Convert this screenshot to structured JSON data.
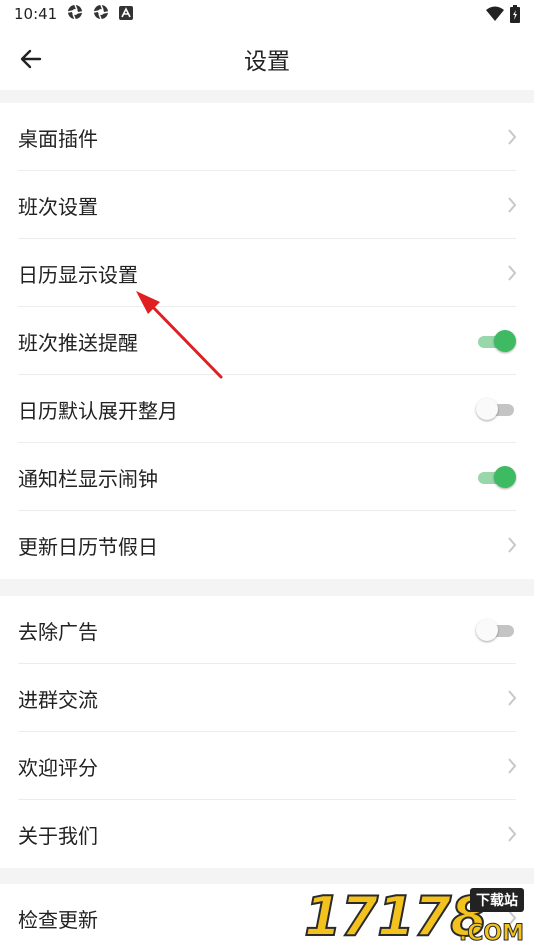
{
  "status_bar": {
    "time": "10:41",
    "left_icons": [
      "aperture-icon",
      "aperture-icon",
      "a-box-icon"
    ],
    "right_icons": [
      "wifi-icon",
      "battery-charging-icon"
    ]
  },
  "header": {
    "title": "设置",
    "back_icon": "arrow-left-icon"
  },
  "groups": [
    {
      "rows": [
        {
          "label": "桌面插件",
          "control": "chevron"
        },
        {
          "label": "班次设置",
          "control": "chevron"
        },
        {
          "label": "日历显示设置",
          "control": "chevron"
        },
        {
          "label": "班次推送提醒",
          "control": "toggle",
          "on": true
        },
        {
          "label": "日历默认展开整月",
          "control": "toggle",
          "on": false
        },
        {
          "label": "通知栏显示闹钟",
          "control": "toggle",
          "on": true
        },
        {
          "label": "更新日历节假日",
          "control": "chevron"
        }
      ]
    },
    {
      "rows": [
        {
          "label": "去除广告",
          "control": "toggle",
          "on": false
        },
        {
          "label": "进群交流",
          "control": "chevron"
        },
        {
          "label": "欢迎评分",
          "control": "chevron"
        },
        {
          "label": "关于我们",
          "control": "chevron"
        }
      ]
    },
    {
      "rows": [
        {
          "label": "检查更新",
          "control": "chevron"
        }
      ]
    }
  ],
  "annotation": {
    "color": "#e02020"
  },
  "watermark": {
    "digits": "17178",
    "tag": "下载站",
    "suffix": ".COM"
  },
  "colors": {
    "toggle_on": "#3dba62",
    "toggle_off": "#c4c4c4",
    "background": "#f4f4f4"
  }
}
